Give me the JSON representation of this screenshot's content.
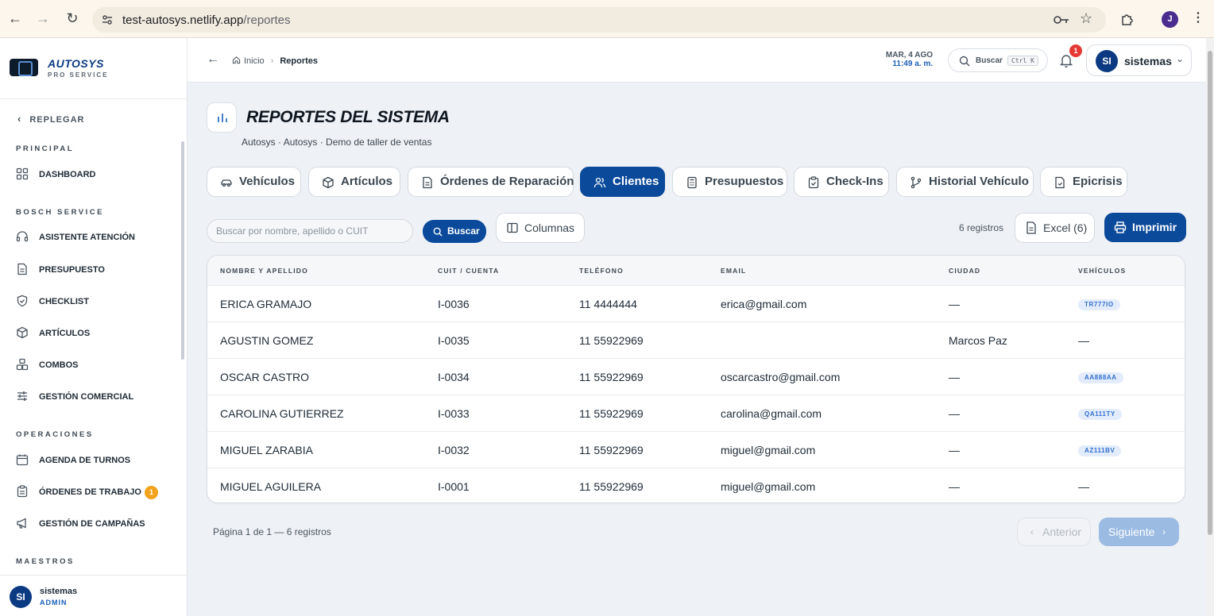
{
  "browser": {
    "url_host": "test-autosys.netlify.app",
    "url_path": "/reportes",
    "profile_initial": "J"
  },
  "brand": {
    "name": "AUTOSYS",
    "subtitle": "PRO SERVICE"
  },
  "sidebar": {
    "collapse_label": "REPLEGAR",
    "sections": {
      "principal": "PRINCIPAL",
      "bosch": "BOSCH SERVICE",
      "operaciones": "OPERACIONES",
      "maestros": "MAESTROS"
    },
    "items": {
      "dashboard": "DASHBOARD",
      "asistente": "ASISTENTE ATENCIÓN",
      "presupuesto": "PRESUPUESTO",
      "checklist": "CHECKLIST",
      "articulos": "ARTÍCULOS",
      "combos": "COMBOS",
      "gestion_comercial": "GESTIÓN COMERCIAL",
      "agenda": "AGENDA DE TURNOS",
      "ordenes": "ÓRDENES DE TRABAJO",
      "ordenes_badge": "1",
      "campanas": "GESTIÓN DE CAMPAÑAS"
    },
    "user": {
      "initials": "SI",
      "name": "sistemas",
      "role": "ADMIN"
    }
  },
  "topbar": {
    "breadcrumb": {
      "home": "Inicio",
      "current": "Reportes"
    },
    "date": "MAR, 4 AGO",
    "time": "11:49 a. m.",
    "search_label": "Buscar",
    "search_shortcut": "Ctrl K",
    "notifications_count": "1",
    "user": {
      "initials": "SI",
      "name": "sistemas"
    }
  },
  "page": {
    "title": "REPORTES DEL SISTEMA",
    "subtitle": "Autosys · Autosys · Demo de taller de ventas"
  },
  "tabs": [
    {
      "label": "Vehículos",
      "icon": "car-icon",
      "active": false
    },
    {
      "label": "Artículos",
      "icon": "box-icon",
      "active": false
    },
    {
      "label": "Órdenes de Reparación",
      "icon": "document-icon",
      "active": false
    },
    {
      "label": "Clientes",
      "icon": "users-icon",
      "active": true
    },
    {
      "label": "Presupuestos",
      "icon": "calculator-icon",
      "active": false
    },
    {
      "label": "Check-Ins",
      "icon": "clipboard-check-icon",
      "active": false
    },
    {
      "label": "Historial Vehículo",
      "icon": "git-branch-icon",
      "active": false
    },
    {
      "label": "Epicrisis",
      "icon": "file-medical-icon",
      "active": false
    }
  ],
  "filters": {
    "search_placeholder": "Buscar por nombre, apellido o CUIT",
    "search_value": "",
    "search_button": "Buscar",
    "columns_button": "Columnas",
    "records": "6 registros",
    "excel_button": "Excel (6)",
    "print_button": "Imprimir"
  },
  "table": {
    "headers": [
      "NOMBRE Y APELLIDO",
      "CUIT / CUENTA",
      "TELÉFONO",
      "EMAIL",
      "CIUDAD",
      "VEHÍCULOS"
    ],
    "rows": [
      {
        "name": "ERICA GRAMAJO",
        "cuit": "I-0036",
        "phone": "11 4444444",
        "email": "erica@gmail.com",
        "city": "—",
        "vehicle": "TR777IO"
      },
      {
        "name": "AGUSTIN GOMEZ",
        "cuit": "I-0035",
        "phone": "11 55922969",
        "email": "",
        "city": "Marcos Paz",
        "vehicle": "—"
      },
      {
        "name": "OSCAR CASTRO",
        "cuit": "I-0034",
        "phone": "11 55922969",
        "email": "oscarcastro@gmail.com",
        "city": "—",
        "vehicle": "AA888AA"
      },
      {
        "name": "CAROLINA GUTIERREZ",
        "cuit": "I-0033",
        "phone": "11 55922969",
        "email": "carolina@gmail.com",
        "city": "—",
        "vehicle": "QA111TY"
      },
      {
        "name": "MIGUEL ZARABIA",
        "cuit": "I-0032",
        "phone": "11 55922969",
        "email": "miguel@gmail.com",
        "city": "—",
        "vehicle": "AZ111BV"
      },
      {
        "name": "MIGUEL AGUILERA",
        "cuit": "I-0001",
        "phone": "11 55922969",
        "email": "miguel@gmail.com",
        "city": "—",
        "vehicle": "—"
      }
    ]
  },
  "pagination": {
    "info": "Página 1 de 1 — 6 registros",
    "prev": "Anterior",
    "next": "Siguiente"
  },
  "colors": {
    "primary": "#0b4a9a",
    "accent": "#1b5fb7",
    "badge_warning": "#f2a21b",
    "badge_alert": "#e53935"
  }
}
